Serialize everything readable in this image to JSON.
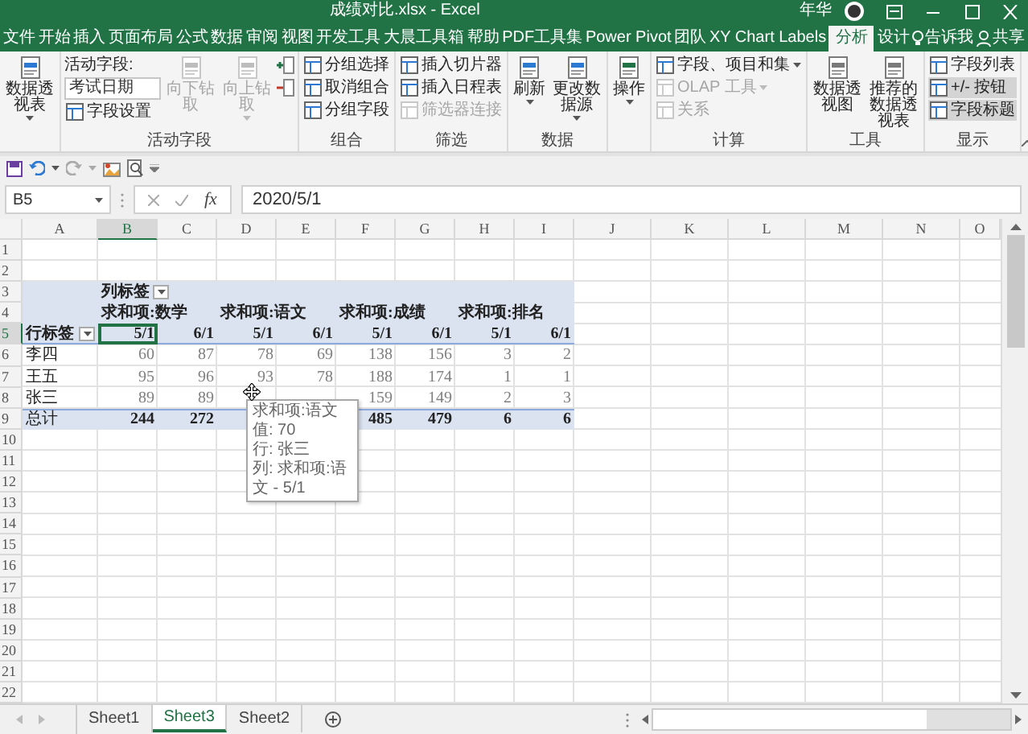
{
  "window": {
    "title": "成绩对比.xlsx - Excel",
    "user": "年华"
  },
  "ribbon_tabs": [
    {
      "label": "文件",
      "selected": false
    },
    {
      "label": "开始",
      "selected": false
    },
    {
      "label": "插入",
      "selected": false
    },
    {
      "label": "页面布局",
      "selected": false
    },
    {
      "label": "公式",
      "selected": false
    },
    {
      "label": "数据",
      "selected": false
    },
    {
      "label": "审阅",
      "selected": false
    },
    {
      "label": "视图",
      "selected": false
    },
    {
      "label": "开发工具",
      "selected": false
    },
    {
      "label": "大晨工具箱",
      "selected": false
    },
    {
      "label": "帮助",
      "selected": false
    },
    {
      "label": "PDF工具集",
      "selected": false
    },
    {
      "label": "Power Pivot",
      "selected": false
    },
    {
      "label": "团队",
      "selected": false
    },
    {
      "label": "XY Chart Labels",
      "selected": false
    },
    {
      "label": "分析",
      "selected": true
    },
    {
      "label": "设计",
      "selected": false
    }
  ],
  "tell_me": "告诉我",
  "share": "共享",
  "ribbon_groups": [
    {
      "columns": [
        [
          {
            "kind": "large",
            "label": "数据透视表",
            "dropdown": true,
            "disabled": false
          }
        ]
      ]
    },
    {
      "name": "活动字段",
      "columns": [
        [
          {
            "kind": "text",
            "label": "活动字段:"
          },
          {
            "kind": "field",
            "value": "考试日期"
          },
          {
            "kind": "small",
            "label": "字段设置",
            "disabled": false
          }
        ],
        [
          {
            "kind": "large",
            "label": "向下钻取",
            "disabled": true
          }
        ],
        [
          {
            "kind": "large",
            "label": "向上钻取",
            "dropdown": true,
            "disabled": true
          }
        ],
        [
          {
            "kind": "icon",
            "disabled": false
          },
          {
            "kind": "icon",
            "disabled": false
          }
        ]
      ]
    },
    {
      "name": "组合",
      "columns": [
        [
          {
            "kind": "small",
            "label": "分组选择",
            "disabled": false
          },
          {
            "kind": "small",
            "label": "取消组合",
            "disabled": false
          },
          {
            "kind": "small",
            "label": "分组字段",
            "disabled": false
          }
        ]
      ]
    },
    {
      "name": "筛选",
      "columns": [
        [
          {
            "kind": "small",
            "label": "插入切片器",
            "disabled": false
          },
          {
            "kind": "small",
            "label": "插入日程表",
            "disabled": false
          },
          {
            "kind": "small",
            "label": "筛选器连接",
            "disabled": true
          }
        ]
      ]
    },
    {
      "name": "数据",
      "columns": [
        [
          {
            "kind": "large",
            "label": "刷新",
            "dropdown": true,
            "disabled": false
          }
        ],
        [
          {
            "kind": "large",
            "label": "更改数据源",
            "dropdown": true,
            "disabled": false
          }
        ]
      ]
    },
    {
      "columns": [
        [
          {
            "kind": "large",
            "label": "操作",
            "dropdown": true,
            "disabled": false
          }
        ]
      ]
    },
    {
      "name": "计算",
      "columns": [
        [
          {
            "kind": "small",
            "label": "字段、项目和集",
            "dropdown": true,
            "disabled": false
          },
          {
            "kind": "small",
            "label": "OLAP 工具",
            "dropdown": true,
            "disabled": true
          },
          {
            "kind": "small",
            "label": "关系",
            "disabled": true
          }
        ]
      ]
    },
    {
      "name": "工具",
      "columns": [
        [
          {
            "kind": "large",
            "label": "数据透视图",
            "disabled": false
          }
        ],
        [
          {
            "kind": "large",
            "label": "推荐的数据透视表",
            "disabled": false
          }
        ]
      ]
    },
    {
      "name": "显示",
      "columns": [
        [
          {
            "kind": "small",
            "label": "字段列表",
            "selected": false
          },
          {
            "kind": "small",
            "label": "+/- 按钮",
            "selected": true
          },
          {
            "kind": "small",
            "label": "字段标题",
            "selected": true
          }
        ]
      ]
    }
  ],
  "formula_bar": {
    "name_box": "B5",
    "function_label": "fx",
    "value": "2020/5/1"
  },
  "sheet": {
    "columns": [
      "A",
      "B",
      "C",
      "D",
      "E",
      "F",
      "G",
      "H",
      "I",
      "J",
      "K",
      "L",
      "M",
      "N",
      "O"
    ],
    "row_numbers": [
      "1",
      "2",
      "3",
      "4",
      "5",
      "6",
      "7",
      "8",
      "9",
      "10",
      "11",
      "12",
      "13",
      "14",
      "15",
      "16",
      "17",
      "18",
      "19",
      "20",
      "21",
      "22"
    ]
  },
  "pivot_table": {
    "filter_label": "列标签",
    "value_fields": [
      "求和项:数学",
      "求和项:语文",
      "求和项:成绩",
      "求和项:排名"
    ],
    "row_label": "行标签",
    "row_labels": [
      "李四",
      "王五",
      "张三"
    ],
    "total_label": "总计",
    "columns": [
      {
        "date": "5/1",
        "selected": true,
        "values": [
          "60",
          "95",
          "89"
        ],
        "total": "244"
      },
      {
        "date": "6/1",
        "selected": false,
        "values": [
          "87",
          "96",
          "89"
        ],
        "total": "272"
      },
      {
        "date": "5/1",
        "selected": false,
        "values": [
          "78",
          "93"
        ]
      },
      {
        "date": "6/1",
        "selected": false,
        "values": [
          "69",
          "78"
        ]
      },
      {
        "date": "5/1",
        "selected": false,
        "values": [
          "138",
          "188",
          "159"
        ],
        "total": "485"
      },
      {
        "date": "6/1",
        "selected": false,
        "values": [
          "156",
          "174",
          "149"
        ],
        "total": "479"
      },
      {
        "date": "5/1",
        "selected": false,
        "values": [
          "3",
          "1",
          "2"
        ],
        "total": "6"
      },
      {
        "date": "6/1",
        "selected": false,
        "values": [
          "2",
          "1",
          "3"
        ],
        "total": "6"
      }
    ]
  },
  "tooltip": {
    "lines": [
      "求和项:语文",
      "值: 70",
      "行: 张三",
      "列: 求和项:语文 - 5/1"
    ]
  },
  "sheet_tabs": [
    {
      "label": "Sheet1",
      "selected": false
    },
    {
      "label": "Sheet3",
      "selected": true
    },
    {
      "label": "Sheet2",
      "selected": false
    }
  ]
}
